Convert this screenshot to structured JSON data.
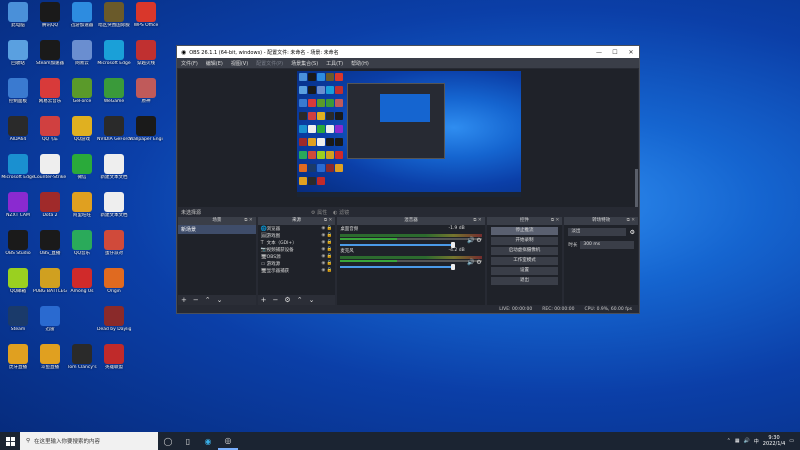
{
  "desktop_icons": [
    {
      "label": "此电脑",
      "color": "#4a90d9",
      "col": 0,
      "row": 0
    },
    {
      "label": "腾讯QQ",
      "color": "#1a1a1a",
      "col": 1,
      "row": 0
    },
    {
      "label": "迅游加速器",
      "color": "#2d8ce0",
      "col": 2,
      "row": 0
    },
    {
      "label": "暗区突围国际服",
      "color": "#6a5a2a",
      "col": 3,
      "row": 0
    },
    {
      "label": "WPS Office",
      "color": "#d9372b",
      "col": 4,
      "row": 0
    },
    {
      "label": "回收站",
      "color": "#5aa0e0",
      "col": 0,
      "row": 1
    },
    {
      "label": "Steam加速器",
      "color": "#1a1a1a",
      "col": 1,
      "row": 1
    },
    {
      "label": "网易云",
      "color": "#6a8ed0",
      "col": 2,
      "row": 1
    },
    {
      "label": "Microsoft Edge",
      "color": "#1aa0d8",
      "col": 3,
      "row": 1
    },
    {
      "label": "穿越火线",
      "color": "#c03030",
      "col": 4,
      "row": 1
    },
    {
      "label": "控制面板",
      "color": "#3a7ad0",
      "col": 0,
      "row": 2
    },
    {
      "label": "网易云音乐",
      "color": "#d83a3a",
      "col": 1,
      "row": 2
    },
    {
      "label": "GeForce",
      "color": "#5a9a2a",
      "col": 2,
      "row": 2
    },
    {
      "label": "WeGame",
      "color": "#3a9a3a",
      "col": 3,
      "row": 2
    },
    {
      "label": "原神",
      "color": "#c05a5a",
      "col": 4,
      "row": 2
    },
    {
      "label": "AIDA64",
      "color": "#2a2a2a",
      "col": 0,
      "row": 3
    },
    {
      "label": "QQ飞车",
      "color": "#d04040",
      "col": 1,
      "row": 3
    },
    {
      "label": "QQ游戏",
      "color": "#e0b020",
      "col": 2,
      "row": 3
    },
    {
      "label": "NVIDIA GeForce",
      "color": "#2a2a2a",
      "col": 3,
      "row": 3
    },
    {
      "label": "Wallpaper Engine",
      "color": "#1a1a1a",
      "col": 4,
      "row": 3
    },
    {
      "label": "Microsoft Edge",
      "color": "#1a90d0",
      "col": 0,
      "row": 4
    },
    {
      "label": "Counter-Strike",
      "color": "#eeeeee",
      "col": 1,
      "row": 4
    },
    {
      "label": "微信",
      "color": "#2aaa3a",
      "col": 2,
      "row": 4
    },
    {
      "label": "新建文本文档",
      "color": "#eeeeee",
      "col": 3,
      "row": 4
    },
    {
      "label": "NZXT CAM",
      "color": "#8a2ad0",
      "col": 0,
      "row": 5
    },
    {
      "label": "Dota 2",
      "color": "#a02a2a",
      "col": 1,
      "row": 5
    },
    {
      "label": "阿里旺旺",
      "color": "#e0a020",
      "col": 2,
      "row": 5
    },
    {
      "label": "新建文本文档",
      "color": "#eeeeee",
      "col": 3,
      "row": 5
    },
    {
      "label": "OBS Studio",
      "color": "#1a1a1a",
      "col": 0,
      "row": 6
    },
    {
      "label": "OBS_直播",
      "color": "#1a1a1a",
      "col": 1,
      "row": 6
    },
    {
      "label": "QQ音乐",
      "color": "#2aaa5a",
      "col": 2,
      "row": 6
    },
    {
      "label": "蛋仔派对",
      "color": "#d04a3a",
      "col": 3,
      "row": 6
    },
    {
      "label": "QQ邮箱",
      "color": "#9ad020",
      "col": 0,
      "row": 7
    },
    {
      "label": "PUBG BATTLEGROUNDS",
      "color": "#d0a020",
      "col": 1,
      "row": 7
    },
    {
      "label": "Among Us",
      "color": "#d02a2a",
      "col": 2,
      "row": 7
    },
    {
      "label": "Origin",
      "color": "#e06a20",
      "col": 3,
      "row": 7
    },
    {
      "label": "Steam",
      "color": "#1a3a6a",
      "col": 0,
      "row": 8
    },
    {
      "label": "迅雷",
      "color": "#2a6ad0",
      "col": 1,
      "row": 8
    },
    {
      "label": "Dead by Daylight",
      "color": "#8a2a2a",
      "col": 3,
      "row": 8
    },
    {
      "label": "虎牙直播",
      "color": "#e0a020",
      "col": 0,
      "row": 9
    },
    {
      "label": "斗鱼直播",
      "color": "#e0a020",
      "col": 1,
      "row": 9
    },
    {
      "label": "Tom Clancy's",
      "color": "#2a2a2a",
      "col": 2,
      "row": 9
    },
    {
      "label": "英雄联盟",
      "color": "#c02a2a",
      "col": 3,
      "row": 9
    }
  ],
  "taskbar": {
    "search_placeholder": "在这里输入你要搜索的内容",
    "time": "9:30",
    "date": "2022/1/4"
  },
  "obs": {
    "title": "OBS 26.1.1 (64-bit, windows) - 配置文件: 未命名 - 场景: 未命名",
    "menu": [
      "文件(F)",
      "编辑(E)",
      "视图(V)",
      "配置文件(P)",
      "场景集合(S)",
      "工具(T)",
      "帮助(H)"
    ],
    "scene_label": "未选择源",
    "props_label": "属性",
    "filters_label": "滤镜",
    "docks": {
      "scenes_title": "场景",
      "sources_title": "来源",
      "mixer_title": "混音器",
      "controls_title": "控件",
      "transitions_title": "转场特效"
    },
    "scene_item": "新场景",
    "sources": [
      {
        "icon": "🌐",
        "name": "浏览器"
      },
      {
        "icon": "🖼",
        "name": "游戏图"
      },
      {
        "icon": "T",
        "name": "文本（GDI+）"
      },
      {
        "icon": "📷",
        "name": "视频捕获设备"
      },
      {
        "icon": "🖥",
        "name": "OBS源"
      },
      {
        "icon": "▭",
        "name": "游戏源"
      },
      {
        "icon": "🖥",
        "name": "显示器捕获"
      }
    ],
    "mixer": [
      {
        "name": "桌面音频",
        "db": "-1.9 dB"
      },
      {
        "name": "麦克风",
        "db": "-4.2 dB"
      }
    ],
    "controls": [
      "停止推流",
      "开始录制",
      "启动虚拟摄像机",
      "工作室模式",
      "设置",
      "退出"
    ],
    "transition": {
      "value": "淡出",
      "duration_label": "时长",
      "duration": "300 ms"
    },
    "status": {
      "live": "LIVE: 00:00:00",
      "rec": "REC: 00:00:00",
      "cpu": "CPU: 0.9%, 60.00 fps"
    }
  }
}
